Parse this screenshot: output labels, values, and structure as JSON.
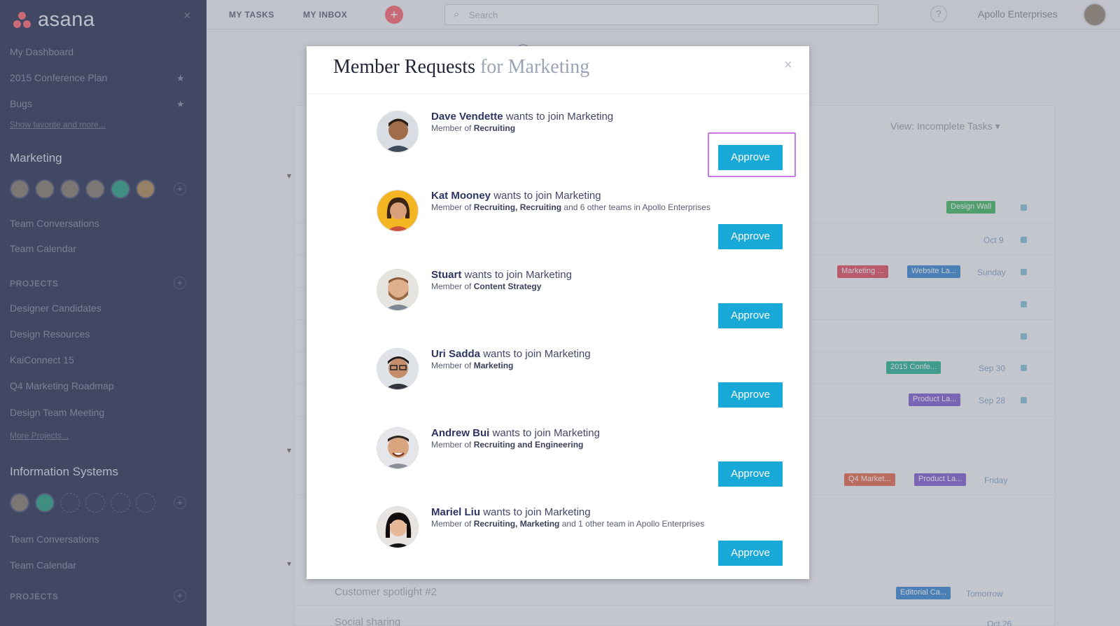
{
  "sidebar": {
    "logo": "asana",
    "links": [
      "My Dashboard",
      "2015 Conference Plan",
      "Bugs"
    ],
    "show_more": "Show favorite and more...",
    "team1": {
      "name": "Marketing",
      "links": [
        "Team Conversations",
        "Team Calendar"
      ],
      "projects_label": "PROJECTS",
      "projects": [
        "Designer Candidates",
        "Design Resources",
        "KaiConnect 15",
        "Q4 Marketing Roadmap",
        "Design Team Meeting"
      ],
      "more_projects": "More Projects..."
    },
    "team2": {
      "name": "Information Systems",
      "links": [
        "Team Conversations",
        "Team Calendar"
      ],
      "projects_label": "PROJECTS"
    }
  },
  "topbar": {
    "tab_my_tasks": "MY TASKS",
    "tab_my_inbox": "MY INBOX",
    "add": "+",
    "search_placeholder": "Search",
    "help": "?",
    "org_name": "Apollo Enterprises"
  },
  "background": {
    "view_filter": "View: Incomplete Tasks ▾",
    "rows": [
      "Customer spotlight #2",
      "Social sharing"
    ],
    "tags": [
      "Design Wall",
      "Marketing ...",
      "Website La...",
      "2015 Confe...",
      "Product La...",
      "Q4 Market...",
      "Product La...",
      "Editorial Ca..."
    ],
    "dates": [
      "Oct 9",
      "Sunday",
      "Sep 30",
      "Sep 28",
      "Friday",
      "Tomorrow",
      "Oct 26"
    ]
  },
  "modal": {
    "title_main": "Member Requests",
    "title_sub": "for Marketing",
    "close": "×",
    "approve_label": "Approve",
    "requests": [
      {
        "name": "Dave Vendette",
        "action": "wants to join Marketing",
        "member_prefix": "Member of",
        "teams": "Recruiting",
        "suffix": ""
      },
      {
        "name": "Kat Mooney",
        "action": "wants to join Marketing",
        "member_prefix": "Member of",
        "teams": "Recruiting, Recruiting",
        "suffix": "and 6 other teams in Apollo Enterprises"
      },
      {
        "name": "Stuart",
        "action": "wants to join Marketing",
        "member_prefix": "Member of",
        "teams": "Content Strategy",
        "suffix": ""
      },
      {
        "name": "Uri Sadda",
        "action": "wants to join Marketing",
        "member_prefix": "Member of",
        "teams": "Marketing",
        "suffix": ""
      },
      {
        "name": "Andrew Bui",
        "action": "wants to join Marketing",
        "member_prefix": "Member of",
        "teams": "Recruiting and Engineering",
        "suffix": ""
      },
      {
        "name": "Mariel Liu",
        "action": "wants to join Marketing",
        "member_prefix": "Member of",
        "teams": "Recruiting, Marketing",
        "suffix": "and 1 other team in Apollo Enterprises"
      }
    ]
  },
  "colors": {
    "sidebar_bg": "#3d4462",
    "approve_bg": "#19a9d8",
    "highlight": "#c97ae6",
    "brand_dots": "#f7707b"
  }
}
